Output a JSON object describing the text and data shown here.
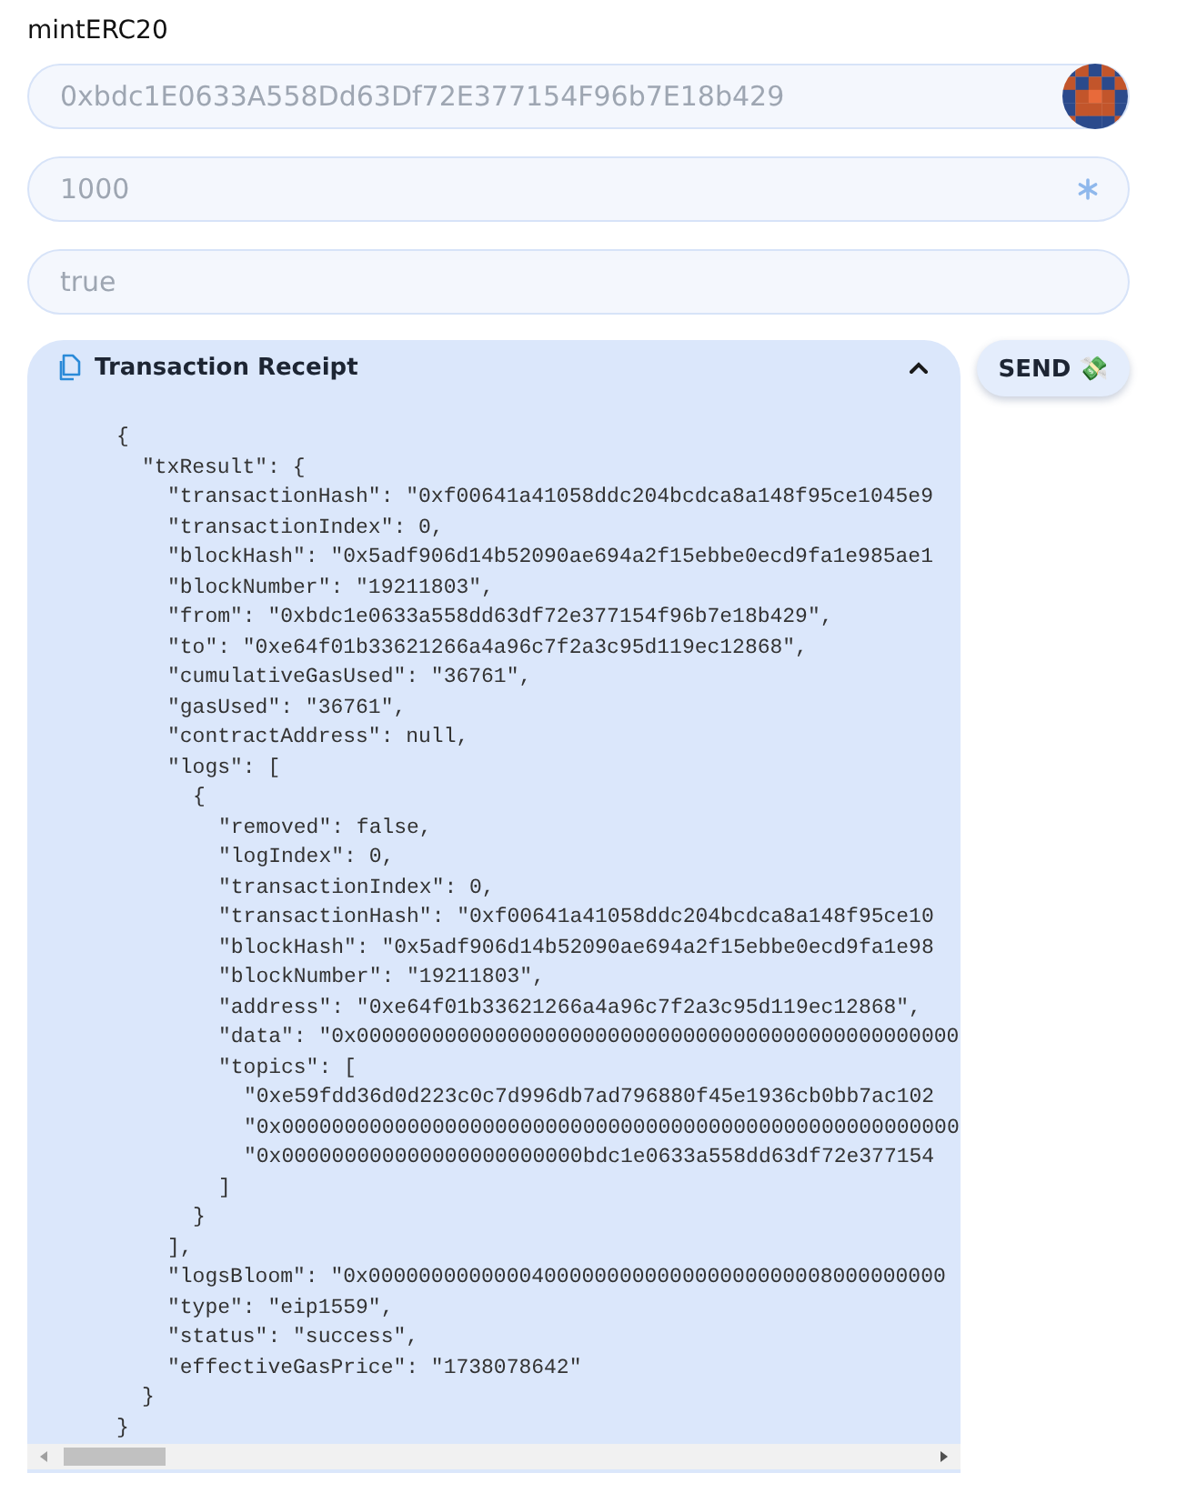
{
  "function": {
    "title": "mintERC20"
  },
  "fields": [
    {
      "kind": "address",
      "value": "0xbdc1E0633A558Dd63Df72E377154F96b7E18b429"
    },
    {
      "kind": "number",
      "value": "1000"
    },
    {
      "kind": "text",
      "value": "true"
    }
  ],
  "receipt": {
    "title": "Transaction Receipt",
    "expanded": true,
    "code": [
      {
        "text": "{",
        "end": "}",
        "children": [
          {
            "text": "\"txResult\": {",
            "end": "}",
            "children": [
              {
                "text": "\"transactionHash\": \"0xf00641a41058ddc204bcdca8a148f95ce1045e9"
              },
              {
                "text": "\"transactionIndex\": 0,"
              },
              {
                "text": "\"blockHash\": \"0x5adf906d14b52090ae694a2f15ebbe0ecd9fa1e985ae1"
              },
              {
                "text": "\"blockNumber\": \"19211803\","
              },
              {
                "text": "\"from\": \"0xbdc1e0633a558dd63df72e377154f96b7e18b429\","
              },
              {
                "text": "\"to\": \"0xe64f01b33621266a4a96c7f2a3c95d119ec12868\","
              },
              {
                "text": "\"cumulativeGasUsed\": \"36761\","
              },
              {
                "text": "\"gasUsed\": \"36761\","
              },
              {
                "text": "\"contractAddress\": null,"
              },
              {
                "text": "\"logs\": [",
                "end": "],",
                "children": [
                  {
                    "text": "{",
                    "end": "}",
                    "children": [
                      {
                        "text": "\"removed\": false,"
                      },
                      {
                        "text": "\"logIndex\": 0,"
                      },
                      {
                        "text": "\"transactionIndex\": 0,"
                      },
                      {
                        "text": "\"transactionHash\": \"0xf00641a41058ddc204bcdca8a148f95ce10"
                      },
                      {
                        "text": "\"blockHash\": \"0x5adf906d14b52090ae694a2f15ebbe0ecd9fa1e98"
                      },
                      {
                        "text": "\"blockNumber\": \"19211803\","
                      },
                      {
                        "text": "\"address\": \"0xe64f01b33621266a4a96c7f2a3c95d119ec12868\","
                      },
                      {
                        "text": "\"data\": \"0x000000000000000000000000000000000000000000000000"
                      },
                      {
                        "text": "\"topics\": [",
                        "end": "]",
                        "children": [
                          {
                            "text": "\"0xe59fdd36d0d223c0c7d996db7ad796880f45e1936cb0bb7ac102"
                          },
                          {
                            "text": "\"0x000000000000000000000000000000000000000000000000000000"
                          },
                          {
                            "text": "\"0x000000000000000000000000bdc1e0633a558dd63df72e377154"
                          }
                        ]
                      }
                    ]
                  }
                ]
              },
              {
                "text": "\"logsBloom\": \"0x0000000000000400000000000000000000008000000000"
              },
              {
                "text": "\"type\": \"eip1559\","
              },
              {
                "text": "\"status\": \"success\","
              },
              {
                "text": "\"effectiveGasPrice\": \"1738078642\""
              }
            ]
          }
        ]
      }
    ]
  },
  "send_button": {
    "label": "SEND 💸"
  }
}
